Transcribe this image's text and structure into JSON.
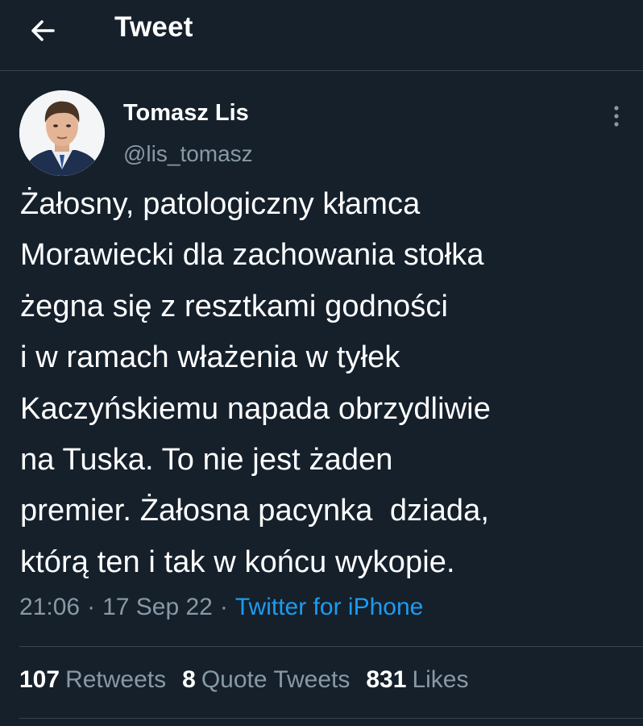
{
  "header": {
    "title": "Tweet",
    "back_icon": "arrow-left-icon"
  },
  "author": {
    "name": "Tomasz Lis",
    "handle": "@lis_tomasz",
    "avatar_icon": "profile-photo"
  },
  "tweet": {
    "text": "Żałosny, patologiczny kłamca\nMorawiecki dla zachowania stołka\nżegna się z resztkami godności\ni w ramach włażenia w tyłek\nKaczyńskiemu napada obrzydliwie\nna Tuska. To nie jest żaden\npremier. Żałosna pacynka  dziada,\nktórą ten i tak w końcu wykopie.",
    "time": "21:06",
    "separator": "·",
    "date": "17 Sep 22",
    "source": "Twitter for iPhone"
  },
  "stats": {
    "retweets_count": "107",
    "retweets_label": "Retweets",
    "quotes_count": "8",
    "quotes_label": "Quote Tweets",
    "likes_count": "831",
    "likes_label": "Likes"
  },
  "colors": {
    "background": "#15202b",
    "text": "#ffffff",
    "muted": "#8899a6",
    "accent": "#1d9bf0",
    "border": "#38444d"
  }
}
